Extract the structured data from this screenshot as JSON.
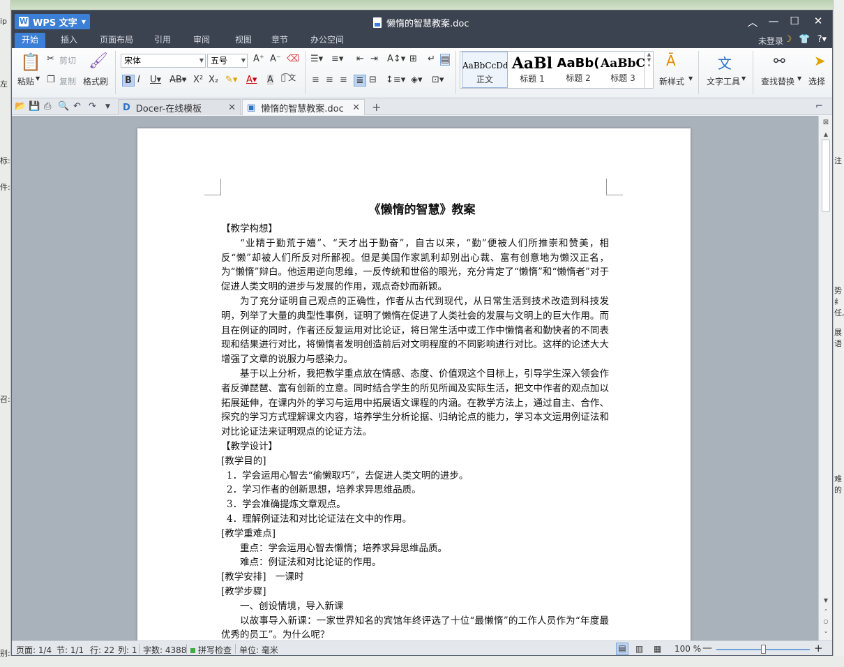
{
  "background": {
    "fragments": [
      "ip",
      "左",
      "标:",
      "件:",
      "召:",
      "别:",
      "注",
      "势纟",
      "任,",
      "展语",
      "难的"
    ]
  },
  "titlebar": {
    "app_name": "WPS 文字",
    "doc_title": "懒惰的智慧教案.doc"
  },
  "menu_tabs": [
    "开始",
    "插入",
    "页面布局",
    "引用",
    "审阅",
    "视图",
    "章节",
    "办公空间"
  ],
  "account": {
    "login": "未登录"
  },
  "ribbon": {
    "paste": "粘贴",
    "cut": "剪切",
    "copy": "复制",
    "format_painter": "格式刷",
    "font_name": "宋体",
    "font_size": "五号",
    "styles": [
      {
        "sample": "AaBbCcDd",
        "name": "正文"
      },
      {
        "sample": "AaBl",
        "name": "标题 1"
      },
      {
        "sample": "AaBb(",
        "name": "标题 2"
      },
      {
        "sample": "AaBbC",
        "name": "标题 3"
      }
    ],
    "new_style": "新样式",
    "text_tools": "文字工具",
    "find_replace": "查找替换",
    "select": "选择"
  },
  "doc_tabs": [
    {
      "label": "Docer-在线模板",
      "active": false
    },
    {
      "label": "懒惰的智慧教案.doc",
      "active": true
    }
  ],
  "document": {
    "title": "《懒惰的智慧》教案",
    "paragraphs": [
      {
        "cls": "",
        "text": "【教学构想】"
      },
      {
        "cls": "indent",
        "text": "“业精于勤荒于嬉”、“天才出于勤奋”，自古以来，“勤”便被人们所推崇和赞美，相反“懒”却被人们所反对所鄙视。但是美国作家凯利却别出心裁、富有创意地为懒汉正名，为“懒惰”辩白。他运用逆向思维，一反传统和世俗的眼光，充分肯定了“懒惰”和“懒惰者”对于促进人类文明的进步与发展的作用，观点奇妙而新颖。"
      },
      {
        "cls": "indent",
        "text": "为了充分证明自己观点的正确性，作者从古代到现代，从日常生活到技术改造到科技发明，列举了大量的典型性事例，证明了懒惰在促进了人类社会的发展与文明上的巨大作用。而且在例证的同时，作者还反复运用对比论证，将日常生活中或工作中懒惰者和勤快者的不同表现和结果进行对比，将懒惰者发明创造前后对文明程度的不同影响进行对比。这样的论述大大增强了文章的说服力与感染力。"
      },
      {
        "cls": "indent",
        "text": "基于以上分析，我把教学重点放在情感、态度、价值观这个目标上，引导学生深入领会作者反弹琵琶、富有创新的立意。同时结合学生的所见所闻及实际生活，把文中作者的观点加以拓展延伸，在课内外的学习与运用中拓展语文课程的内涵。在教学方法上，通过自主、合作、探究的学习方式理解课文内容，培养学生分析论据、归纳论点的能力，学习本文运用例证法和对比论证法来证明观点的论证方法。"
      },
      {
        "cls": "",
        "text": "【教学设计】"
      },
      {
        "cls": "",
        "text": "[教学目的]"
      },
      {
        "cls": "li",
        "text": "1．学会运用心智去“偷懒取巧”，去促进人类文明的进步。"
      },
      {
        "cls": "li",
        "text": "2．学习作者的创新思想，培养求异思维品质。"
      },
      {
        "cls": "li",
        "text": "3．学会准确提炼文章观点。"
      },
      {
        "cls": "li",
        "text": "4．理解例证法和对比论证法在文中的作用。"
      },
      {
        "cls": "",
        "text": "[教学重难点]"
      },
      {
        "cls": "pad2",
        "text": "重点：学会运用心智去懒惰；培养求异思维品质。"
      },
      {
        "cls": "pad2",
        "text": "难点：例证法和对比论证的作用。"
      },
      {
        "cls": "",
        "text": "[教学安排]　一课时"
      },
      {
        "cls": "",
        "text": "[教学步骤]"
      },
      {
        "cls": "pad2",
        "text": "一、创设情境，导入新课"
      },
      {
        "cls": "indent",
        "text": "以故事导入新课：一家世界知名的宾馆年终评选了十位“最懒惰”的工作人员作为“年度最优秀的员工”。为什么呢？"
      }
    ]
  },
  "statusbar": {
    "page": "页面: 1/4",
    "section": "节: 1/1",
    "row": "行: 22",
    "col": "列: 1",
    "word_count": "字数: 4388",
    "spell_check": "拼写检查",
    "unit": "单位: 毫米",
    "zoom": "100 %",
    "zoom_fraction": 0.5
  }
}
